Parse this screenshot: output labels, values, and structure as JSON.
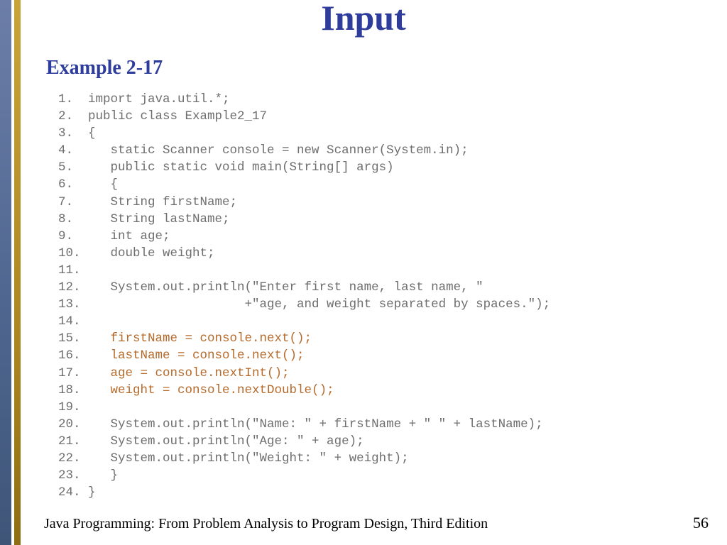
{
  "title": "Input",
  "subtitle": "Example 2-17",
  "code_plain": [
    "1.  import java.util.*;",
    "2.  public class Example2_17",
    "3.  {",
    "4.     static Scanner console = new Scanner(System.in);",
    "5.     public static void main(String[] args)",
    "6.     {",
    "7.     String firstName;",
    "8.     String lastName;",
    "9.     int age;",
    "10.    double weight;",
    "11.",
    "12.    System.out.println(\"Enter first name, last name, \"",
    "13.                      +\"age, and weight separated by spaces.\");",
    "14.",
    "15.    firstName = console.next();",
    "16.    lastName = console.next();",
    "17.    age = console.nextInt();",
    "18.    weight = console.nextDouble();",
    "19.",
    "20.    System.out.println(\"Name: \" + firstName + \" \" + lastName);",
    "21.    System.out.println(\"Age: \" + age);",
    "22.    System.out.println(\"Weight: \" + weight);",
    "23.    }",
    "24. }"
  ],
  "highlight_lines": [
    15,
    16,
    17,
    18
  ],
  "footer_left": "Java Programming: From Problem Analysis to Program Design, Third Edition",
  "footer_right": "56"
}
